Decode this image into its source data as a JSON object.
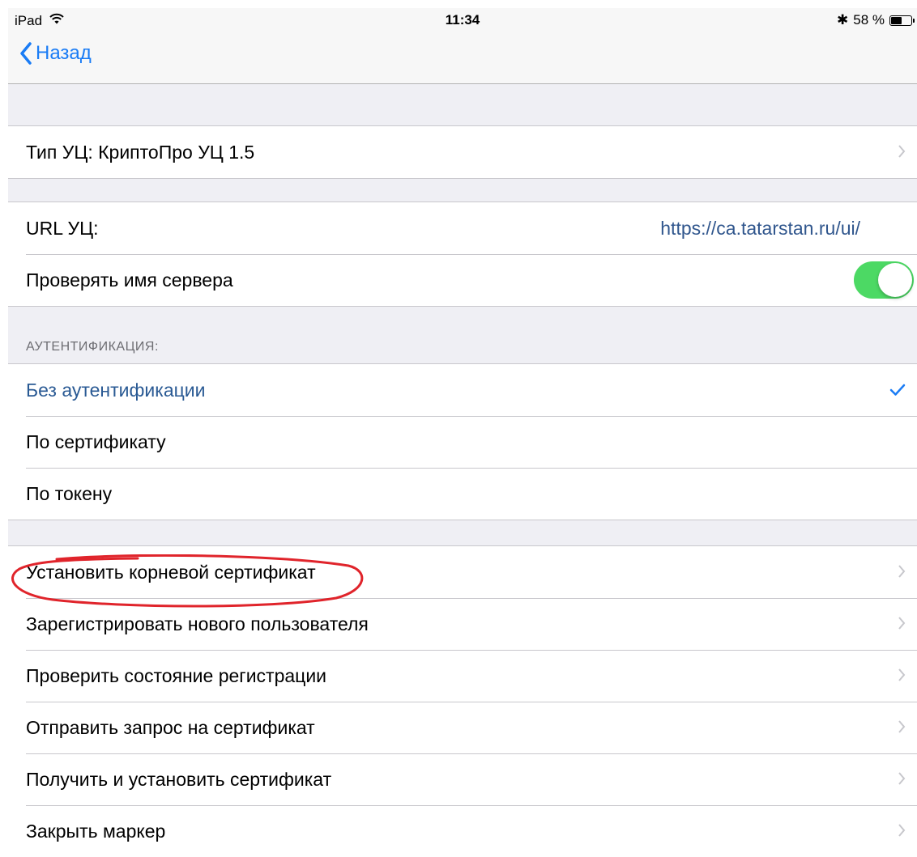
{
  "status": {
    "device": "iPad",
    "time": "11:34",
    "battery": "58 %",
    "battery_level": 0.58,
    "bluetooth_glyph": "✱"
  },
  "nav": {
    "back_label": "Назад"
  },
  "ca_type": {
    "label": "Тип УЦ: КриптоПро УЦ 1.5"
  },
  "url": {
    "label": "URL УЦ:",
    "value": "https://ca.tatarstan.ru/ui/"
  },
  "check_server": {
    "label": "Проверять имя сервера",
    "enabled": true
  },
  "auth": {
    "header": "АУТЕНТИФИКАЦИЯ:",
    "options": [
      {
        "label": "Без аутентификации",
        "selected": true
      },
      {
        "label": "По сертификату",
        "selected": false
      },
      {
        "label": "По токену",
        "selected": false
      }
    ]
  },
  "actions": [
    {
      "label": "Установить корневой сертификат"
    },
    {
      "label": "Зарегистрировать нового пользователя"
    },
    {
      "label": "Проверить состояние регистрации"
    },
    {
      "label": "Отправить запрос на сертификат"
    },
    {
      "label": "Получить и установить сертификат"
    },
    {
      "label": "Закрыть маркер"
    }
  ],
  "colors": {
    "accent": "#1a7cf5",
    "toggle_on": "#4cd964",
    "annotation": "#e0242b"
  }
}
